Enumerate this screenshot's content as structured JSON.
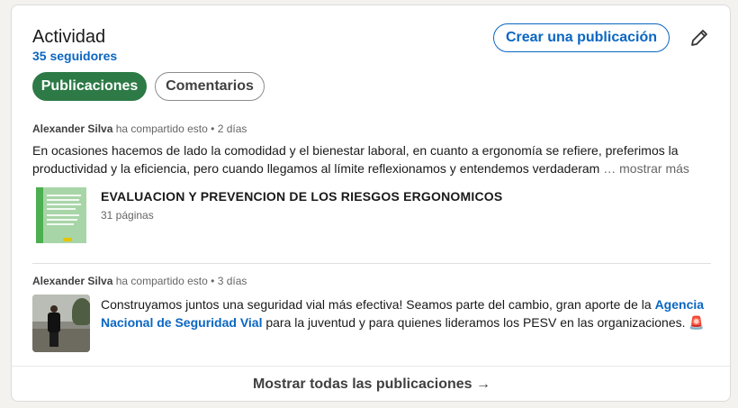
{
  "section": {
    "title": "Actividad",
    "followers": "35 seguidores",
    "create_button": "Crear una publicación"
  },
  "filters": {
    "active": "Publicaciones",
    "inactive": "Comentarios"
  },
  "posts": [
    {
      "author": "Alexander Silva",
      "action": "ha compartido esto",
      "separator": "•",
      "time": "2 días",
      "text": "En ocasiones hacemos de lado la comodidad y el bienestar laboral, en cuanto a ergonomía se refiere, preferimos la productividad y la eficiencia, pero cuando llegamos al límite reflexionamos y entendemos verdaderam",
      "more_label": "… mostrar más",
      "document": {
        "title": "EVALUACION Y PREVENCION DE LOS RIESGOS ERGONOMICOS",
        "pages": "31 páginas"
      }
    },
    {
      "author": "Alexander Silva",
      "action": "ha compartido esto",
      "separator": "•",
      "time": "3 días",
      "text_before": "Construyamos juntos una seguridad vial más efectiva! Seamos parte del cambio, gran aporte de la ",
      "mention": "Agencia Nacional de Seguridad Vial",
      "text_after": " para la juventud y para quienes lideramos los PESV en las organizaciones. ",
      "emoji": "🚨"
    }
  ],
  "footer": {
    "label": "Mostrar todas las publicaciones →"
  },
  "colors": {
    "accent": "#0a66c2",
    "active_filter": "#2d7a46"
  }
}
